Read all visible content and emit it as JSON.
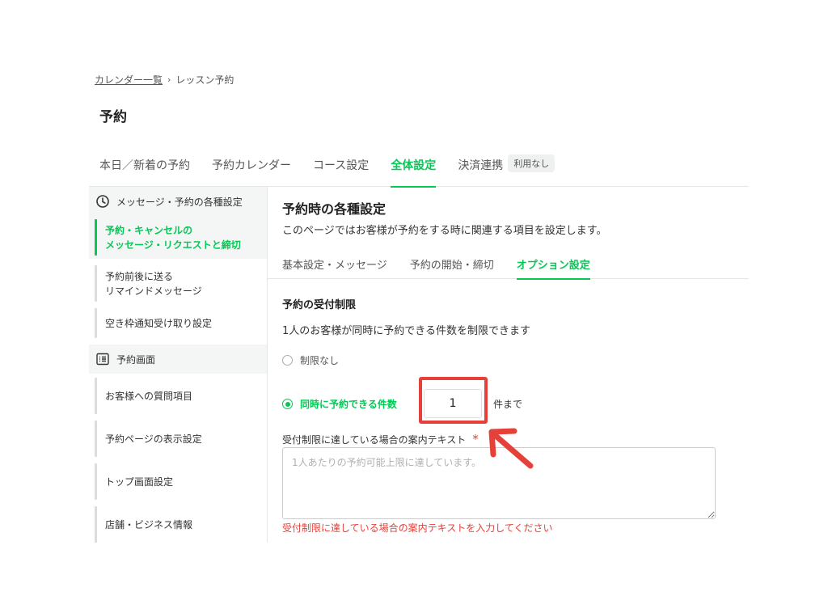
{
  "breadcrumb": {
    "link_label": "カレンダー一覧",
    "separator": "›",
    "current_label": "レッスン予約"
  },
  "page_title": "予約",
  "top_tabs": [
    {
      "label": "本日／新着の予約",
      "active": false
    },
    {
      "label": "予約カレンダー",
      "active": false
    },
    {
      "label": "コース設定",
      "active": false
    },
    {
      "label": "全体設定",
      "active": true
    },
    {
      "label": "決済連携",
      "active": false
    }
  ],
  "payment_badge": "利用なし",
  "sidebar": {
    "section1": {
      "icon": "clock-icon",
      "label": "メッセージ・予約の各種設定"
    },
    "section1_items": [
      {
        "line1": "予約・キャンセルの",
        "line2": "メッセージ・リクエストと締切",
        "active": true
      },
      {
        "line1": "予約前後に送る",
        "line2": "リマインドメッセージ",
        "active": false
      },
      {
        "line1": "空き枠通知受け取り設定",
        "line2": "",
        "active": false
      }
    ],
    "section2": {
      "icon": "list-icon",
      "label": "予約画面"
    },
    "section2_items": [
      {
        "label": "お客様への質問項目"
      },
      {
        "label": "予約ページの表示設定"
      },
      {
        "label": "トップ画面設定"
      },
      {
        "label": "店舗・ビジネス情報"
      }
    ]
  },
  "content": {
    "title": "予約時の各種設定",
    "description": "このページではお客様が予約をする時に関連する項目を設定します。",
    "sub_tabs": [
      {
        "label": "基本設定・メッセージ",
        "active": false
      },
      {
        "label": "予約の開始・締切",
        "active": false
      },
      {
        "label": "オプション設定",
        "active": true
      }
    ],
    "section_title": "予約の受付制限",
    "section_description": "1人のお客様が同時に予約できる件数を制限できます",
    "radio_no_limit": "制限なし",
    "radio_limit": "同時に予約できる件数",
    "limit_value": "1",
    "limit_unit": "件まで",
    "field_label": "受付制限に達している場合の案内テキスト",
    "required_mark": "*",
    "textarea_placeholder": "1人あたりの予約可能上限に達しています。",
    "textarea_value": "",
    "error_message": "受付制限に達している場合の案内テキストを入力してください"
  },
  "colors": {
    "accent": "#06c755",
    "highlight": "#e5413a",
    "error": "#e5413a"
  }
}
